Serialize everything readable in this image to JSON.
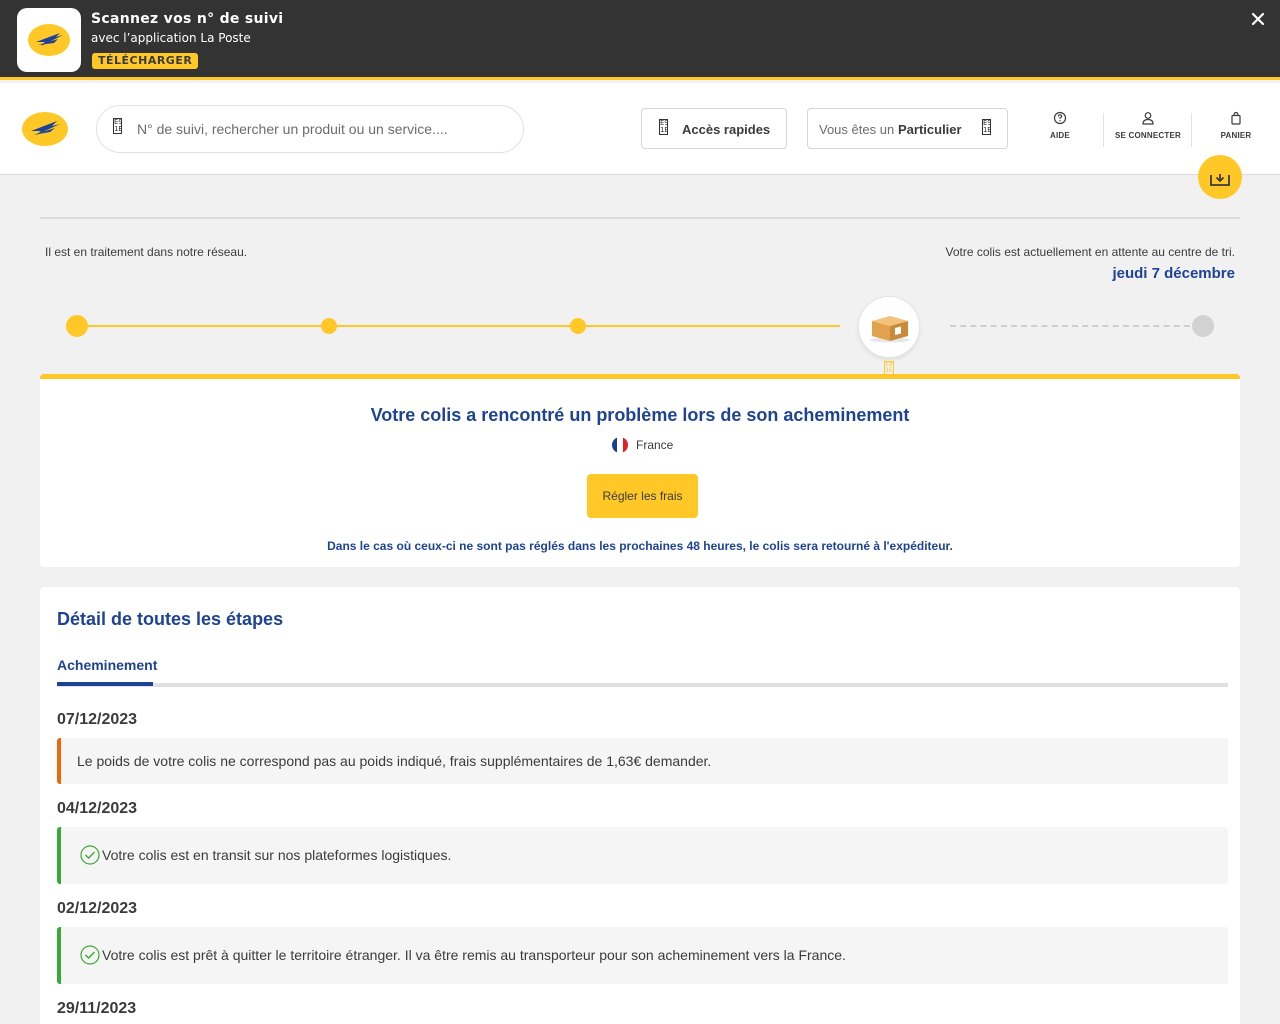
{
  "app_banner": {
    "title": "Scannez vos n° de suivi",
    "subtitle": "avec l’application La Poste",
    "download_label": "TÉLÉCHARGER"
  },
  "header": {
    "search_placeholder": "N° de suivi, rechercher un produit ou un service....",
    "quick_access_label": "Accès rapides",
    "profile_prefix": "Vous êtes un",
    "profile_value": "Particulier",
    "nav": {
      "help": "AIDE",
      "login": "SE CONNECTER",
      "cart": "PANIER"
    }
  },
  "progress": {
    "left_note": "Il est en traitement dans notre réseau.",
    "right_note": "Votre colis est actuellement en attente au centre de tri.",
    "right_date": "jeudi 7 décembre"
  },
  "alert": {
    "title": "Votre colis a rencontré un problème lors de son acheminement",
    "country": "France",
    "pay_button": "Régler les frais",
    "warning": "Dans le cas où ceux-ci ne sont pas réglés dans les prochaines 48 heures, le colis sera retourné à l'expéditeur."
  },
  "steps": {
    "title": "Détail de toutes les étapes",
    "tab_label": "Acheminement",
    "items": [
      {
        "date": "07/12/2023",
        "text": "Le poids de votre colis ne correspond pas au poids indiqué, frais supplémentaires de 1,63€ demander."
      },
      {
        "date": "04/12/2023",
        "text": "Votre colis est en transit sur nos plateformes logistiques."
      },
      {
        "date": "02/12/2023",
        "text": "Votre colis est prêt à quitter le territoire étranger. Il va être remis au transporteur pour son acheminement vers la France."
      },
      {
        "date": "29/11/2023"
      }
    ]
  },
  "colors": {
    "brand_yellow": "#ffc827",
    "brand_blue": "#1e4394",
    "warning_orange": "#ea690b",
    "success_green": "#3ba935"
  }
}
